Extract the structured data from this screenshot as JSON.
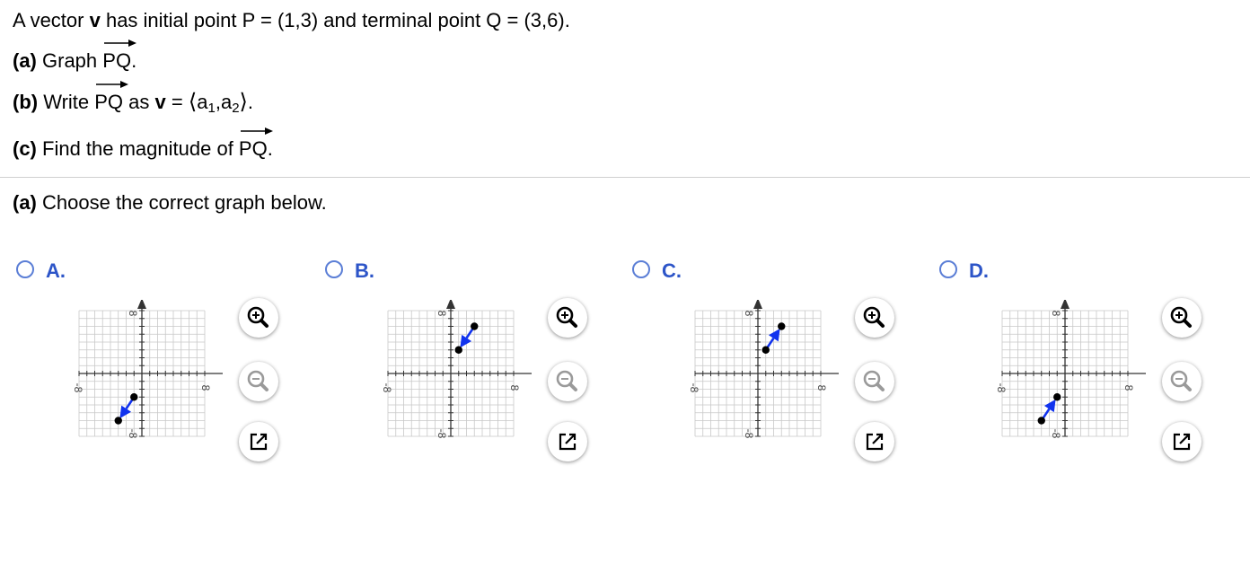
{
  "question": {
    "intro_pre": "A vector ",
    "intro_v": "v",
    "intro_post": " has initial point P = (1,3) and terminal point Q = (3,6).",
    "part_a_tag": "(a)",
    "part_a_text": " Graph ",
    "part_b_tag": "(b)",
    "part_b_text": " Write ",
    "part_b_as": " as ",
    "part_b_v": "v",
    "part_b_eq": " = ",
    "part_c_tag": "(c)",
    "part_c_text": " Find the magnitude of ",
    "vector_name": "PQ",
    "period": ".",
    "angle_open": "⟨",
    "angle_close": "⟩",
    "a": "a",
    "sub1": "1",
    "comma": ",",
    "sub2": "2"
  },
  "subquestion": {
    "tag": "(a)",
    "text": " Choose the correct graph below."
  },
  "graph_axis": {
    "min": -8,
    "max": 8,
    "tick_pos": "8",
    "tick_neg": "-8"
  },
  "options": [
    {
      "label": "A.",
      "p": [
        -3,
        -6
      ],
      "q": [
        -1,
        -3
      ],
      "arrow_to": "p"
    },
    {
      "label": "B.",
      "p": [
        1,
        3
      ],
      "q": [
        3,
        6
      ],
      "arrow_to": "p"
    },
    {
      "label": "C.",
      "p": [
        1,
        3
      ],
      "q": [
        3,
        6
      ],
      "arrow_to": "q"
    },
    {
      "label": "D.",
      "p": [
        -3,
        -6
      ],
      "q": [
        -1,
        -3
      ],
      "arrow_to": "q"
    }
  ],
  "tools": {
    "zoom_in": "zoom-in-icon",
    "zoom_out": "zoom-out-icon",
    "popout": "popout-icon"
  },
  "colors": {
    "vector": "#1133ee",
    "option_label": "#2d55c8",
    "radio": "#5b7ed6",
    "grid": "#c8c8c8"
  }
}
